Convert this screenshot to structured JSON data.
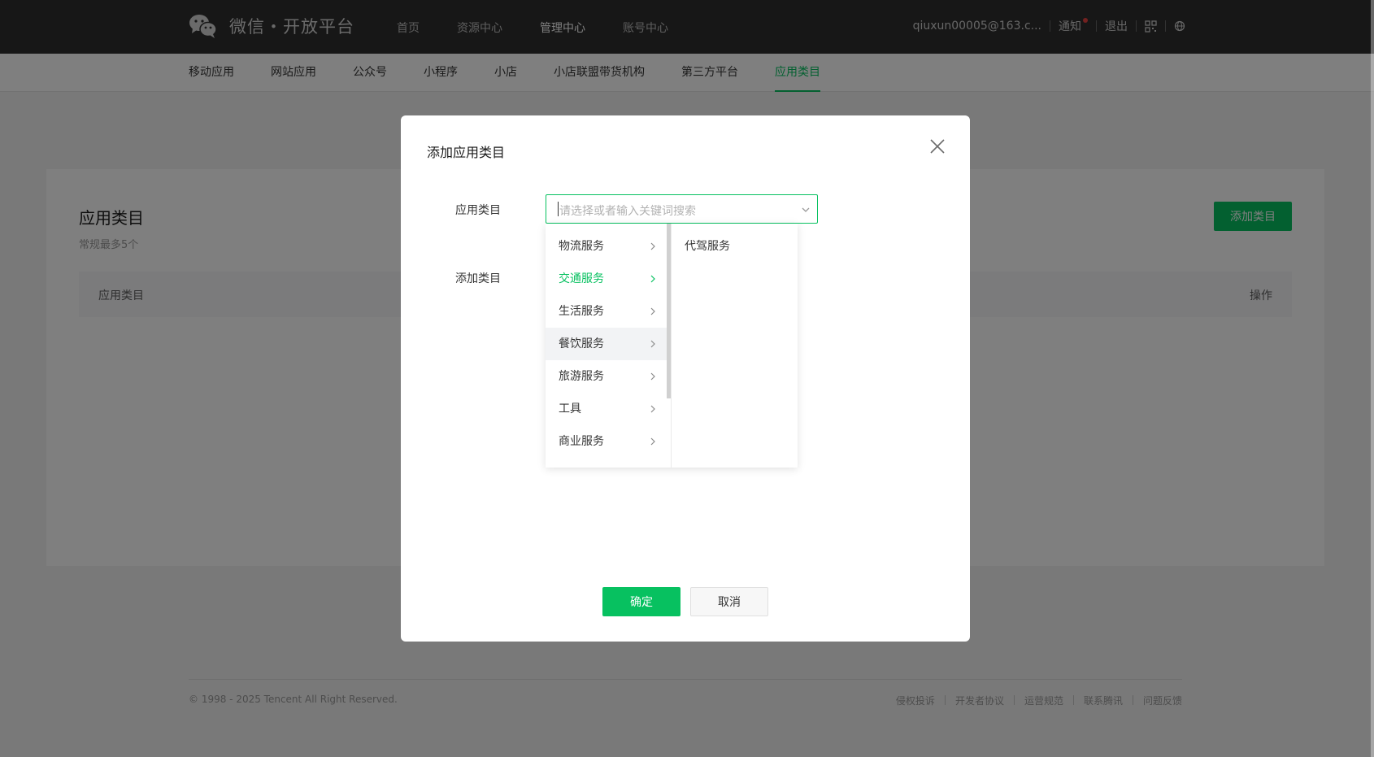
{
  "header": {
    "logo_text": "微信・开放平台",
    "nav": [
      "首页",
      "资源中心",
      "管理中心",
      "账号中心"
    ],
    "active_nav": "管理中心",
    "account": "qiuxun00005@163.c...",
    "notice": "通知",
    "logout": "退出"
  },
  "subnav": {
    "items": [
      "移动应用",
      "网站应用",
      "公众号",
      "小程序",
      "小店",
      "小店联盟带货机构",
      "第三方平台",
      "应用类目"
    ],
    "active": "应用类目"
  },
  "page": {
    "title": "应用类目",
    "subtitle": "常规最多5个",
    "add_button": "添加类目",
    "table_headers": [
      "应用类目",
      "操作"
    ]
  },
  "modal": {
    "title": "添加应用类目",
    "field_label": "应用类目",
    "add_label": "添加类目",
    "placeholder": "请选择或者输入关键词搜索",
    "level1_options": [
      "物流服务",
      "交通服务",
      "生活服务",
      "餐饮服务",
      "旅游服务",
      "工具",
      "商业服务"
    ],
    "level1_selected": "交通服务",
    "level1_hovered": "餐饮服务",
    "level2_options": [
      "代驾服务"
    ],
    "confirm": "确定",
    "cancel": "取消"
  },
  "footer": {
    "copyright": "© 1998 - 2025 Tencent All Right Reserved.",
    "links": [
      "侵权投诉",
      "开发者协议",
      "运营规范",
      "联系腾讯",
      "问题反馈"
    ]
  },
  "colors": {
    "accent": "#07c160",
    "topbar": "#2e2e2e"
  }
}
